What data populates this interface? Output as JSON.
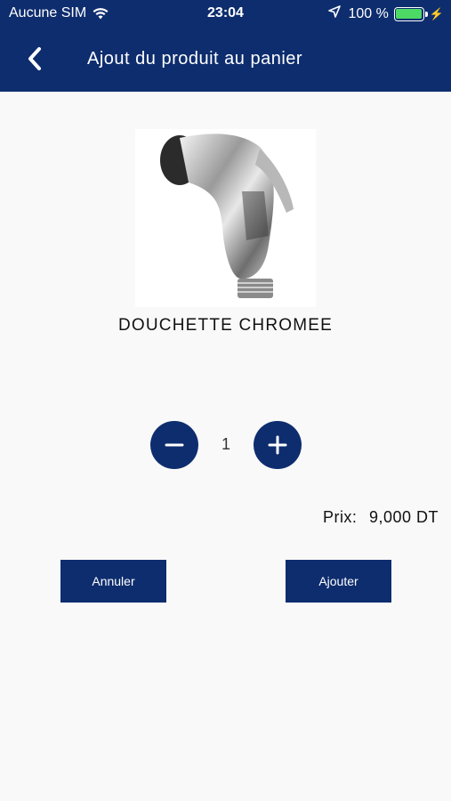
{
  "status_bar": {
    "carrier": "Aucune SIM",
    "time": "23:04",
    "battery": "100 %",
    "battery_color": "#4cd964",
    "icons": [
      "wifi-icon",
      "location-icon",
      "battery-icon",
      "charging-icon"
    ]
  },
  "header": {
    "title": "Ajout du produit au panier",
    "back_icon": "chevron-left-icon",
    "color": "#0e2d6e"
  },
  "product": {
    "name": "DOUCHETTE CHROMEE",
    "image_icon": "shower-head-image"
  },
  "quantity": {
    "value": "1",
    "minus_icon": "minus-icon",
    "plus_icon": "plus-icon"
  },
  "price": {
    "label": "Prix:",
    "value": "9,000 DT"
  },
  "actions": {
    "cancel_label": "Annuler",
    "add_label": "Ajouter"
  }
}
